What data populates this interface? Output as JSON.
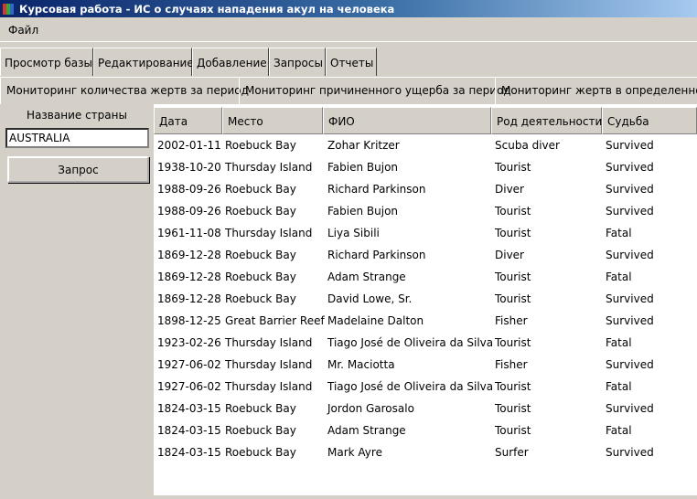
{
  "window": {
    "title": "Курсовая работа - ИС о случаях нападения акул на человека"
  },
  "menu": {
    "items": [
      "Файл"
    ]
  },
  "tabs": [
    "Просмотр базы",
    "Редактирование",
    "Добавление",
    "Запросы",
    "Отчеты"
  ],
  "subtabs": [
    "Мониторинг количества жертв за период",
    "Мониторинг причиненного ущерба за период",
    "Мониторинг жертв в определенном"
  ],
  "query_panel": {
    "label": "Название страны",
    "input_value": "AUSTRALIA",
    "button_label": "Запрос"
  },
  "table": {
    "columns": [
      "Дата",
      "Место",
      "ФИО",
      "Род деятельности",
      "Судьба"
    ],
    "rows": [
      [
        "2002-01-11",
        "Roebuck Bay",
        "Zohar Kritzer",
        "Scuba diver",
        "Survived"
      ],
      [
        "1938-10-20",
        "Thursday Island",
        "Fabien Bujon",
        "Tourist",
        "Survived"
      ],
      [
        "1988-09-26",
        "Roebuck Bay",
        "Richard Parkinson",
        "Diver",
        "Survived"
      ],
      [
        "1988-09-26",
        "Roebuck Bay",
        "Fabien Bujon",
        "Tourist",
        "Survived"
      ],
      [
        "1961-11-08",
        "Thursday Island",
        "Liya Sibili",
        "Tourist",
        "Fatal"
      ],
      [
        "1869-12-28",
        "Roebuck Bay",
        "Richard Parkinson",
        "Diver",
        "Survived"
      ],
      [
        "1869-12-28",
        "Roebuck Bay",
        "Adam Strange",
        "Tourist",
        "Fatal"
      ],
      [
        "1869-12-28",
        "Roebuck Bay",
        "David Lowe, Sr.",
        "Tourist",
        "Survived"
      ],
      [
        "1898-12-25",
        "Great Barrier Reef",
        "Madelaine Dalton",
        "Fisher",
        "Survived"
      ],
      [
        "1923-02-26",
        "Thursday Island",
        "Tiago José de Oliveira da Silva",
        "Tourist",
        "Fatal"
      ],
      [
        "1927-06-02",
        "Thursday Island",
        "Mr. Maciotta",
        "Fisher",
        "Survived"
      ],
      [
        "1927-06-02",
        "Thursday Island",
        "Tiago José de Oliveira da Silva",
        "Tourist",
        "Fatal"
      ],
      [
        "1824-03-15",
        "Roebuck Bay",
        "Jordon Garosalo",
        "Tourist",
        "Survived"
      ],
      [
        "1824-03-15",
        "Roebuck Bay",
        "Adam Strange",
        "Tourist",
        "Fatal"
      ],
      [
        "1824-03-15",
        "Roebuck Bay",
        "Mark Ayre",
        "Surfer",
        "Survived"
      ]
    ]
  }
}
